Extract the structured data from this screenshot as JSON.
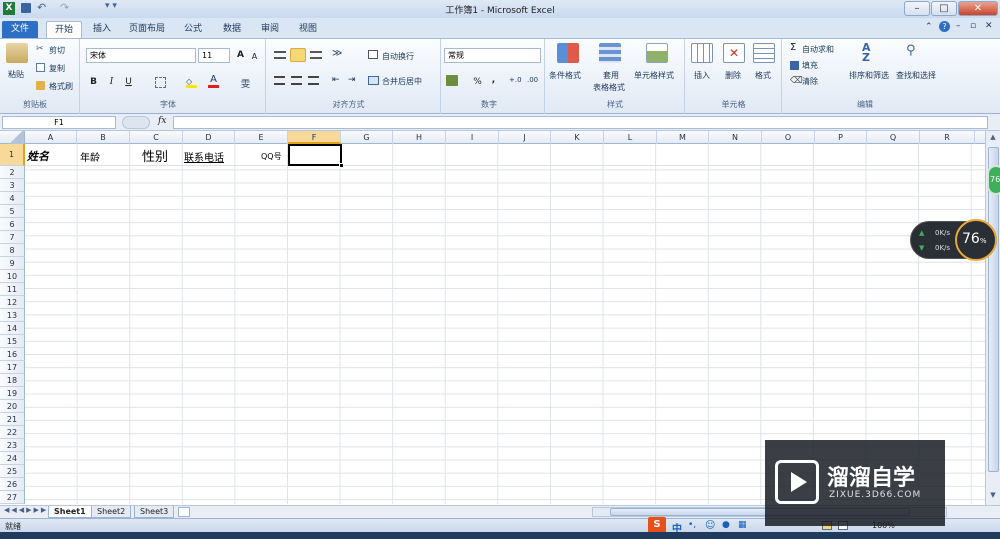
{
  "titlebar": {
    "title": "工作簿1 - Microsoft Excel",
    "min": "–",
    "max": "□",
    "close": "✕"
  },
  "tabs": [
    "文件",
    "开始",
    "插入",
    "页面布局",
    "公式",
    "数据",
    "审阅",
    "视图"
  ],
  "ribbon": {
    "clipboard": {
      "paste": "粘贴",
      "cut": "剪切",
      "copy": "复制",
      "format_painter": "格式刷",
      "label": "剪贴板"
    },
    "font": {
      "font_name": "宋体",
      "font_size": "11",
      "bold": "B",
      "italic": "I",
      "underline": "U",
      "grow": "A",
      "shrink": "A",
      "label": "字体"
    },
    "alignment": {
      "wrap": "自动换行",
      "merge": "合并后居中",
      "label": "对齐方式"
    },
    "number": {
      "format": "常规",
      "percent": "%",
      "comma": ",",
      "label": "数字"
    },
    "styles": {
      "conditional": "条件格式",
      "table_line1": "套用",
      "table_line2": "表格格式",
      "cell_styles": "单元格样式",
      "label": "样式"
    },
    "cells": {
      "insert": "插入",
      "delete": "删除",
      "format": "格式",
      "label": "单元格"
    },
    "editing": {
      "autosum": "自动求和",
      "fill": "填充",
      "clear": "清除",
      "sort": "排序和筛选",
      "find": "查找和选择",
      "label": "编辑"
    }
  },
  "formula_bar": {
    "name_box": "F1",
    "fx": "fx",
    "value": ""
  },
  "columns": [
    "A",
    "B",
    "C",
    "D",
    "E",
    "F",
    "G",
    "H",
    "I",
    "J",
    "K",
    "L",
    "M",
    "N",
    "O",
    "P",
    "Q",
    "R"
  ],
  "rows": [
    "1",
    "2",
    "3",
    "4",
    "5",
    "6",
    "7",
    "8",
    "9",
    "10",
    "11",
    "12",
    "13",
    "14",
    "15",
    "16",
    "17",
    "18",
    "19",
    "20",
    "21",
    "22",
    "23",
    "24",
    "25",
    "26",
    "27"
  ],
  "cells": {
    "A1": "姓名",
    "B1": "年龄",
    "C1": "性别",
    "D1": "联系电话",
    "E1": "QQ号"
  },
  "sheets": [
    "Sheet1",
    "Sheet2",
    "Sheet3"
  ],
  "status": {
    "ready": "就绪",
    "zoom": "100%"
  },
  "speed_widget": {
    "up": "0K/s",
    "down": "0K/s",
    "percent": "76",
    "percent_unit": "%",
    "small_badge": "76"
  },
  "watermark": {
    "brand": "溜溜自学",
    "url": "ZIXUE.3D66.COM"
  },
  "ime": {
    "logo": "S",
    "lang": "中",
    "punct": "•,"
  }
}
